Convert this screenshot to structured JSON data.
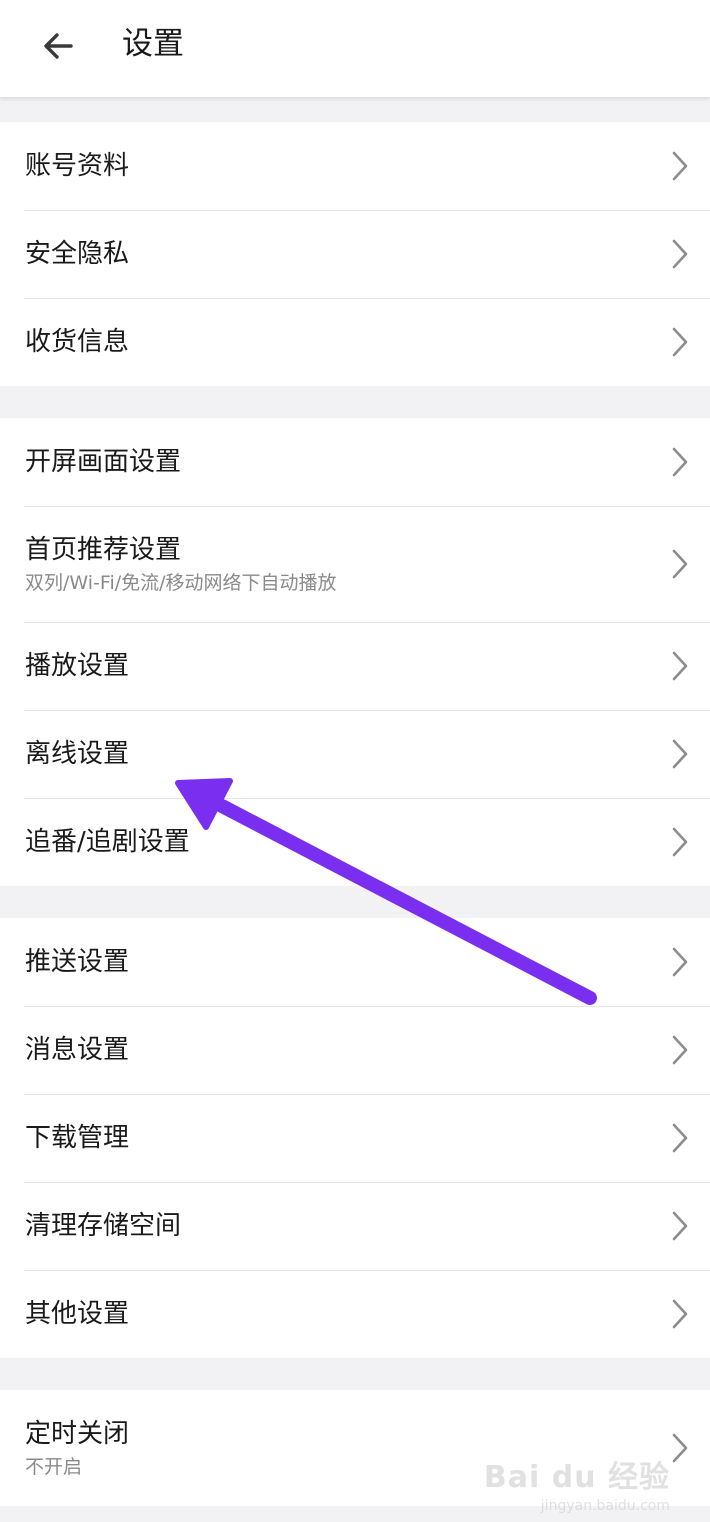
{
  "header": {
    "title": "设置",
    "back_icon": "arrow-left-icon"
  },
  "groups": [
    {
      "items": [
        {
          "label": "账号资料"
        },
        {
          "label": "安全隐私"
        },
        {
          "label": "收货信息"
        }
      ]
    },
    {
      "items": [
        {
          "label": "开屏画面设置"
        },
        {
          "label": "首页推荐设置",
          "sub": "双列/Wi-Fi/免流/移动网络下自动播放"
        },
        {
          "label": "播放设置"
        },
        {
          "label": "离线设置"
        },
        {
          "label": "追番/追剧设置"
        }
      ]
    },
    {
      "items": [
        {
          "label": "推送设置"
        },
        {
          "label": "消息设置"
        },
        {
          "label": "下载管理"
        },
        {
          "label": "清理存储空间"
        },
        {
          "label": "其他设置"
        }
      ]
    },
    {
      "items": [
        {
          "label": "定时关闭",
          "sub": "不开启"
        }
      ]
    }
  ],
  "annotation": {
    "color": "#7a2ff0",
    "icon": "pointer-arrow-icon"
  },
  "watermark": {
    "logo": "Bai du 经验",
    "url": "jingyan.baidu.com"
  },
  "colors": {
    "background": "#f2f2f4",
    "surface": "#ffffff",
    "divider": "#e6e6e6",
    "chevron": "#8c8c8c",
    "secondary_text": "#8a8a8a"
  }
}
